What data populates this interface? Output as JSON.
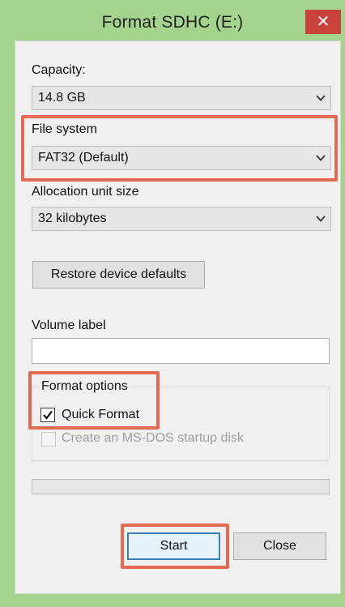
{
  "dialog": {
    "title": "Format SDHC (E:)",
    "close_glyph": "✕"
  },
  "capacity": {
    "label": "Capacity:",
    "value": "14.8 GB"
  },
  "file_system": {
    "label": "File system",
    "value": "FAT32 (Default)"
  },
  "allocation": {
    "label": "Allocation unit size",
    "value": "32 kilobytes"
  },
  "restore_button": "Restore device defaults",
  "volume": {
    "label": "Volume label",
    "value": ""
  },
  "format_options": {
    "label": "Format options",
    "quick_format": {
      "label": "Quick Format",
      "checked": true,
      "enabled": true
    },
    "msdos_disk": {
      "label": "Create an MS-DOS startup disk",
      "checked": false,
      "enabled": false
    }
  },
  "progress": {
    "fraction": 0
  },
  "buttons": {
    "start": "Start",
    "close": "Close"
  },
  "colors": {
    "frame": "#a3d38c",
    "close_button": "#c9413b",
    "highlight": "#e26a53"
  }
}
